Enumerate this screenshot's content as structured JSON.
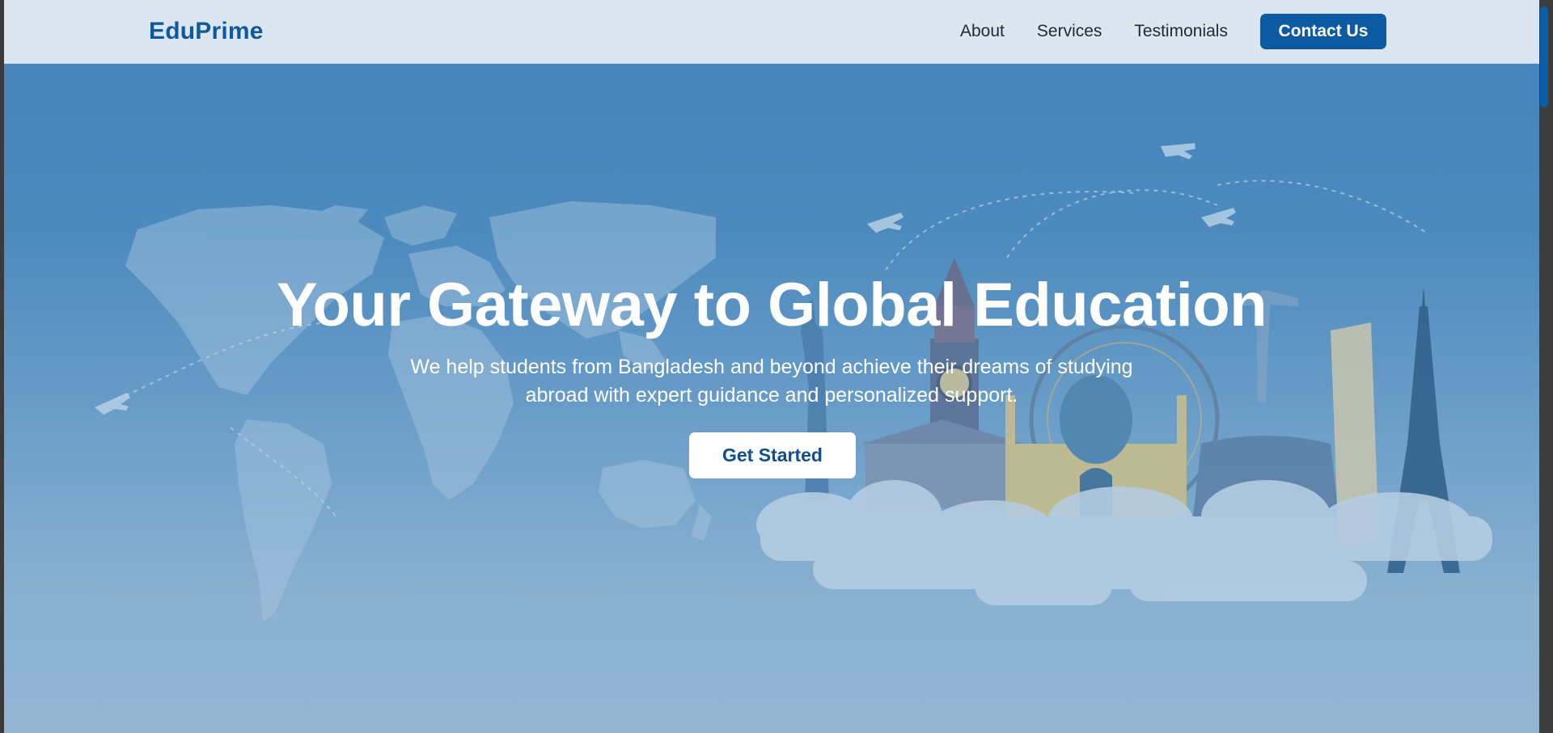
{
  "nav": {
    "brand": "EduPrime",
    "links": [
      "About",
      "Services",
      "Testimonials"
    ],
    "contact": "Contact Us"
  },
  "hero": {
    "title": "Your Gateway to Global Education",
    "subtitle_line1": "We help students from Bangladesh and beyond achieve their dreams of studying",
    "subtitle_line2": "abroad with expert guidance and personalized support.",
    "cta": "Get Started"
  },
  "colors": {
    "brand": "#0e5a9a",
    "accent_button": "#0c5aa1",
    "hero_top": "#4585ba",
    "hero_bottom": "#93b6d2"
  }
}
